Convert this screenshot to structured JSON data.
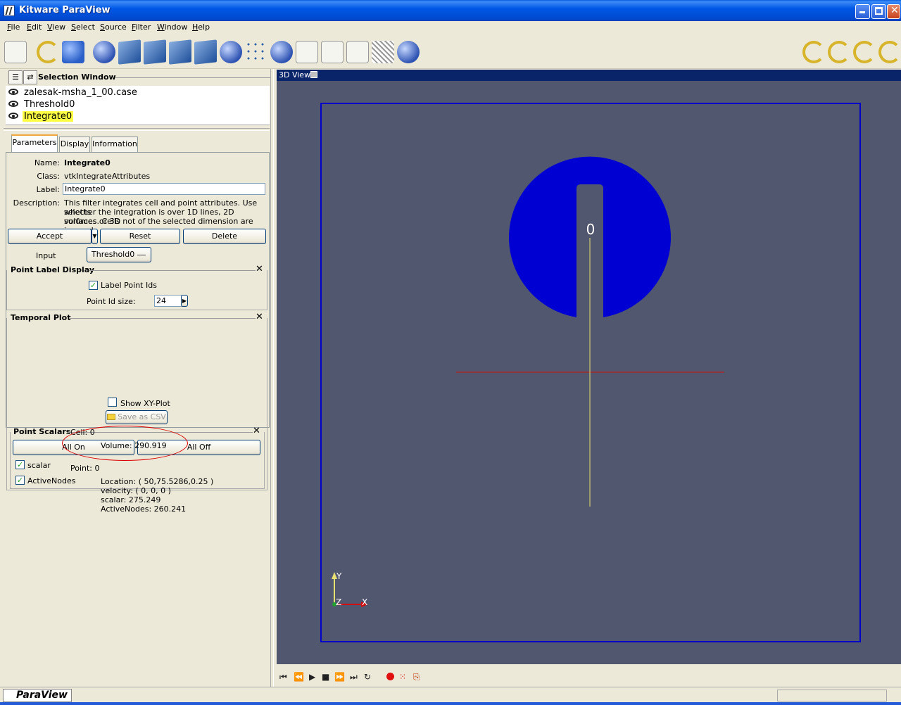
{
  "window": {
    "title": "Kitware ParaView"
  },
  "menu": [
    "File",
    "Edit",
    "View",
    "Select",
    "Source",
    "Filter",
    "Window",
    "Help"
  ],
  "pipeline": {
    "title": "Selection Window",
    "items": [
      {
        "label": "zalesak-msha_1_00.case"
      },
      {
        "label": "Threshold0"
      },
      {
        "label": "Integrate0",
        "selected": true
      }
    ]
  },
  "tabs": [
    "Parameters",
    "Display",
    "Information"
  ],
  "parameters": {
    "name_label": "Name:",
    "name_value": "Integrate0",
    "class_label": "Class:",
    "class_value": "vtkIntegrateAttributes",
    "label_label": "Label:",
    "label_value": "Integrate0",
    "desc_label": "Description:",
    "desc_lines": [
      "This filter integrates cell and point attributes.  Use selects",
      "whether the integration is over 1D lines, 2D surfaces or 3D",
      "volumes.  Cells not of the selected dimension are ignored."
    ],
    "accept": "Accept",
    "reset": "Reset",
    "delete": "Delete",
    "input_label": "Input",
    "input_value": "Threshold0"
  },
  "point_label_display": {
    "title": "Point Label Display",
    "checkbox_label": "Label Point Ids",
    "checked": true,
    "size_label": "Point Id size:",
    "size_value": "24"
  },
  "temporal_plot": {
    "title": "Temporal Plot",
    "show_xy_label": "Show XY-Plot",
    "save_csv": "Save as CSV",
    "point_scalars": {
      "title": "Point Scalars",
      "all_on": "All On",
      "all_off": "All Off",
      "items": [
        {
          "label": "scalar",
          "checked": true
        },
        {
          "label": "ActiveNodes",
          "checked": true
        }
      ]
    }
  },
  "info": {
    "cell": "Cell: 0",
    "volume": "Volume: 290.919",
    "point": "Point: 0",
    "location": "Location: ( 50,75.5286,0.25 )",
    "velocity": "velocity: ( 0, 0, 0 )",
    "scalar": "scalar: 275.249",
    "active_nodes": "ActiveNodes: 260.241"
  },
  "view": {
    "title": "3D View",
    "point_id_label": "0",
    "axes": {
      "y": "Y",
      "z": "Z",
      "x": "X"
    }
  },
  "status": {
    "app": "ParaView"
  },
  "colors": {
    "disk": "#0000D2",
    "background": "#525770",
    "frame": "#0000C8"
  }
}
